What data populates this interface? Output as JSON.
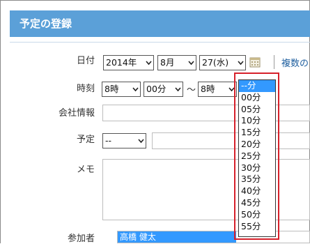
{
  "header": {
    "title": "予定の登録"
  },
  "labels": {
    "date": "日付",
    "time": "時刻",
    "company": "会社情報",
    "schedule": "予定",
    "memo": "メモ",
    "participants": "参加者"
  },
  "date": {
    "year": "2014年",
    "month": "8月",
    "day": "27(水)",
    "multiple_link": "複数の"
  },
  "time": {
    "start_hour": "8時",
    "start_minute": "00分",
    "separator": "〜",
    "end_hour": "8時",
    "end_minute": "--分"
  },
  "schedule": {
    "type": "--"
  },
  "participants": {
    "selected": "高橋 健太"
  },
  "minute_dropdown": {
    "options": [
      "--分",
      "00分",
      "05分",
      "10分",
      "15分",
      "20分",
      "25分",
      "30分",
      "35分",
      "40分",
      "45分",
      "50分",
      "55分"
    ],
    "highlight_color": "#d6202a",
    "selected_color": "#3399ff"
  },
  "colors": {
    "title_bar": "#5ba0d8",
    "link": "#1f5f9f"
  }
}
